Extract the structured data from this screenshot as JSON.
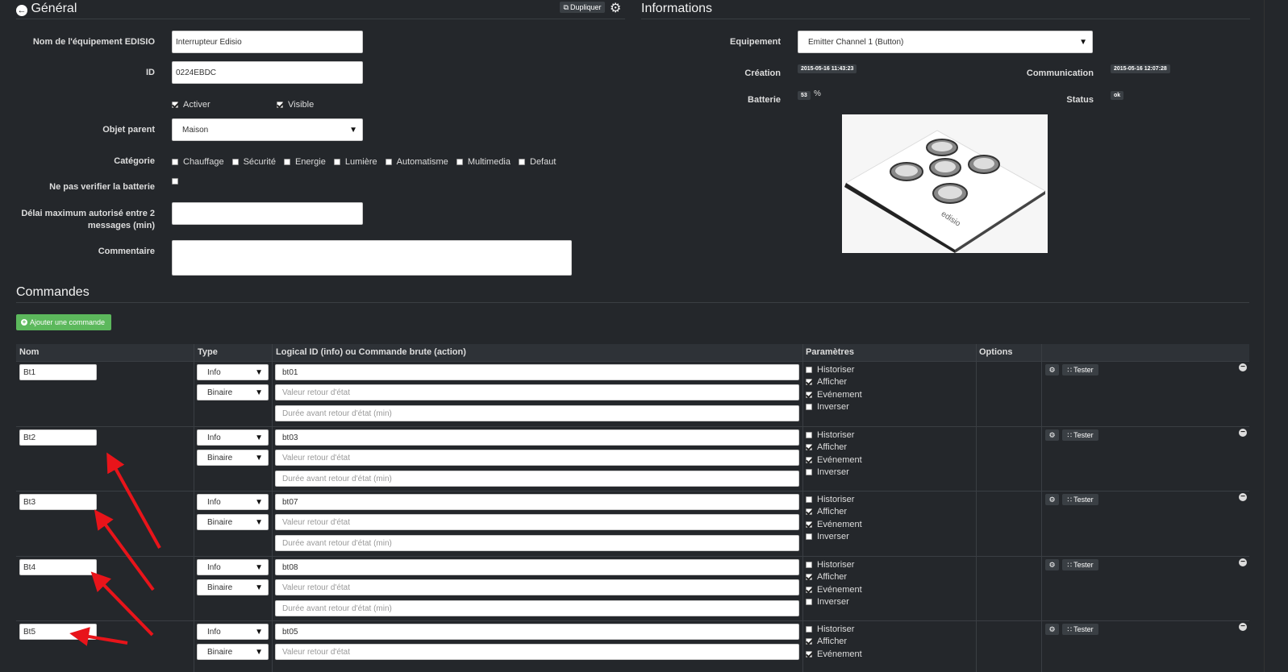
{
  "general": {
    "title": "Général",
    "duplicate_label": "Dupliquer",
    "fields": {
      "name_label": "Nom de l'équipement EDISIO",
      "name_value": "Interrupteur Edisio",
      "id_label": "ID",
      "id_value": "0224EBDC",
      "activer_label": "Activer",
      "visible_label": "Visible",
      "parent_label": "Objet parent",
      "parent_value": "Maison",
      "category_label": "Catégorie",
      "categories": [
        "Chauffage",
        "Sécurité",
        "Energie",
        "Lumière",
        "Automatisme",
        "Multimedia",
        "Defaut"
      ],
      "battery_check_label": "Ne pas verifier la batterie",
      "delay_label_1": "Délai maximum autorisé entre 2",
      "delay_label_2": "messages (min)",
      "comment_label": "Commentaire"
    }
  },
  "informations": {
    "title": "Informations",
    "equipment_label": "Equipement",
    "equipment_value": "Emitter Channel 1 (Button)",
    "creation_label": "Création",
    "creation_value": "2015-05-16 11:43:23",
    "communication_label": "Communication",
    "communication_value": "2015-05-16 12:07:28",
    "battery_label": "Batterie",
    "battery_value": "53",
    "battery_unit": "%",
    "status_label": "Status",
    "status_value": "ok",
    "image_brand": "edisio"
  },
  "commandes": {
    "title": "Commandes",
    "add_label": "Ajouter une commande",
    "columns": {
      "nom": "Nom",
      "type": "Type",
      "logical": "Logical ID (info) ou Commande brute (action)",
      "params": "Paramètres",
      "options": "Options"
    },
    "placeholders": {
      "valeur": "Valeur retour d'état",
      "duree": "Durée avant retour d'état (min)"
    },
    "param_labels": [
      "Historiser",
      "Afficher",
      "Evénement",
      "Inverser"
    ],
    "test_label": "Tester",
    "rows": [
      {
        "name": "Bt1",
        "type": "Info",
        "subtype": "Binaire",
        "logical": "bt01"
      },
      {
        "name": "Bt2",
        "type": "Info",
        "subtype": "Binaire",
        "logical": "bt03"
      },
      {
        "name": "Bt3",
        "type": "Info",
        "subtype": "Binaire",
        "logical": "bt07"
      },
      {
        "name": "Bt4",
        "type": "Info",
        "subtype": "Binaire",
        "logical": "bt08"
      },
      {
        "name": "Bt5",
        "type": "Info",
        "subtype": "Binaire",
        "logical": "bt05"
      }
    ]
  },
  "colors": {
    "background": "#24272b",
    "green": "#5cb85c",
    "arrow": "#e8141a"
  }
}
